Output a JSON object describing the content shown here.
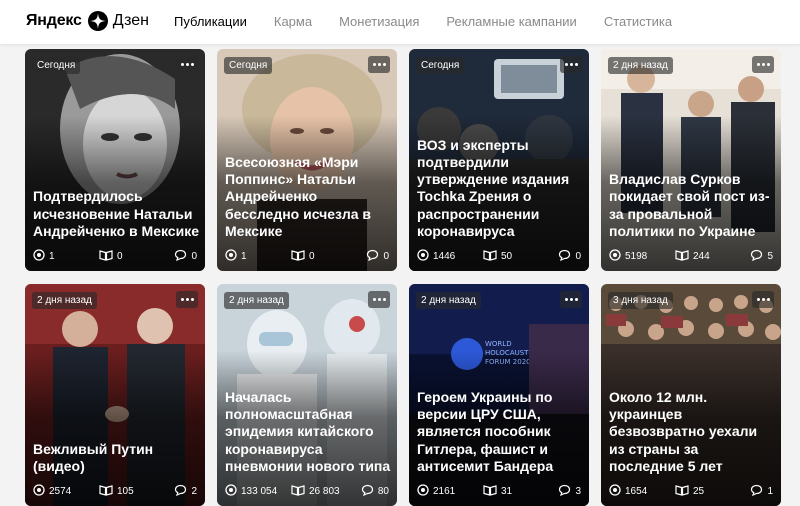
{
  "header": {
    "logo_yandex": "Яндекс",
    "logo_dzen": "Дзен",
    "nav": [
      {
        "label": "Публикации",
        "active": true
      },
      {
        "label": "Карма",
        "active": false
      },
      {
        "label": "Монетизация",
        "active": false
      },
      {
        "label": "Рекламные кампании",
        "active": false
      },
      {
        "label": "Статистика",
        "active": false
      }
    ]
  },
  "cards": [
    {
      "date": "Сегодня",
      "title": "Подтвердилось исчезновение Натальи Андрейченко в Мексике",
      "views": "1",
      "reads": "0",
      "comments": "0",
      "image": "portrait-woman-bw"
    },
    {
      "date": "Сегодня",
      "title": "Всесоюзная «Мэри Поппинс» Натальи Андрейченко бесследно исчезла в Мексике",
      "views": "1",
      "reads": "0",
      "comments": "0",
      "image": "portrait-woman-smiling"
    },
    {
      "date": "Сегодня",
      "title": "ВОЗ и эксперты подтвердили утверждение издания Tochka Zpения о распространении коронавируса",
      "views": "1446",
      "reads": "50",
      "comments": "0",
      "image": "crowd-photographers"
    },
    {
      "date": "2 дня назад",
      "title": "Владислав Сурков покидает свой пост из-за провальной политики по Украине",
      "views": "5198",
      "reads": "244",
      "comments": "5",
      "image": "officials-meeting"
    },
    {
      "date": "2 дня назад",
      "title": "Вежливый Путин (видео)",
      "views": "2574",
      "reads": "105",
      "comments": "2",
      "image": "handshake-leaders"
    },
    {
      "date": "2 дня назад",
      "title": "Началась полномасштабная эпидемия китайского коронавируса пневмонии нового типа",
      "views": "133 054",
      "reads": "26 803",
      "comments": "80",
      "image": "medics-hazmat"
    },
    {
      "date": "2 дня назад",
      "title": "Героем Украины по версии ЦРУ США, является пособник Гитлера, фашист и антисемит Бандера",
      "views": "2161",
      "reads": "31",
      "comments": "3",
      "image": "forum-stage"
    },
    {
      "date": "3 дня назад",
      "title": "Около 12 млн. украинцев безвозвратно уехали из страны за последние 5 лет",
      "views": "1654",
      "reads": "25",
      "comments": "1",
      "image": "large-crowd"
    }
  ]
}
